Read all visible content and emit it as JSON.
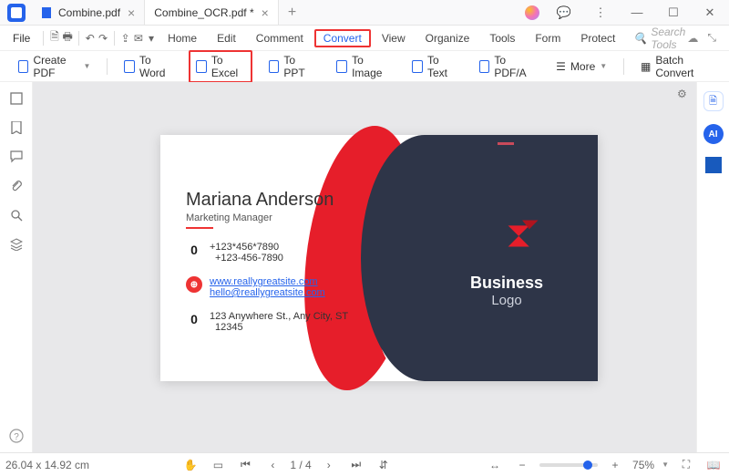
{
  "tabs": [
    {
      "label": "Combine.pdf"
    },
    {
      "label": "Combine_OCR.pdf *"
    }
  ],
  "menubar": {
    "file": "File",
    "items": [
      "Home",
      "Edit",
      "Comment",
      "Convert",
      "View",
      "Organize",
      "Tools",
      "Form",
      "Protect"
    ],
    "search_placeholder": "Search Tools"
  },
  "toolbar": {
    "create": "Create PDF",
    "to_word": "To Word",
    "to_excel": "To Excel",
    "to_ppt": "To PPT",
    "to_image": "To Image",
    "to_text": "To Text",
    "to_pdfa": "To PDF/A",
    "more": "More",
    "batch": "Batch Convert"
  },
  "card": {
    "name": "Mariana Anderson",
    "role": "Marketing Manager",
    "phone1": "+123*456*7890",
    "phone2": "+123-456-7890",
    "site": "www.reallygreatsite.com",
    "email": "hello@reallygreatsite.com",
    "addr1": "123 Anywhere St., Any City, ST",
    "addr2": "12345",
    "brand1": "Business",
    "brand2": "Logo"
  },
  "status": {
    "dims": "26.04 x 14.92 cm",
    "page": "1 / 4",
    "zoom": "75%"
  }
}
